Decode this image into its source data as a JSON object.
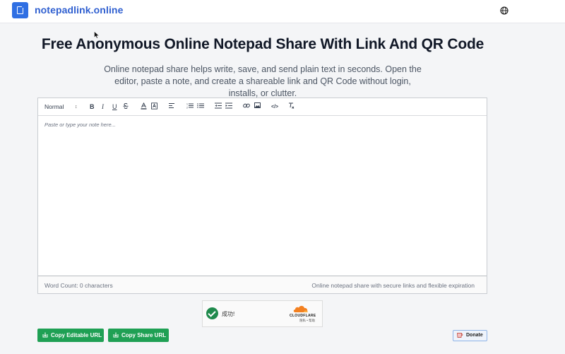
{
  "header": {
    "brand": "notepadlink.online",
    "logo_icon": "document-icon",
    "language_icon": "globe-icon"
  },
  "main": {
    "title": "Free Anonymous Online Notepad Share With Link And QR Code",
    "subtitle": "Online notepad share helps write, save, and send plain text in seconds. Open the editor, paste a note, and create a shareable link and QR Code without login, installs, or clutter."
  },
  "editor": {
    "toolbar": {
      "format_value": "Normal",
      "bold_label": "B",
      "italic_label": "I",
      "underline_label": "U",
      "code_label": "</>",
      "icons": [
        "format-select",
        "bold-icon",
        "italic-icon",
        "underline-icon",
        "strikethrough-icon",
        "text-color-icon",
        "background-color-icon",
        "align-icon",
        "ordered-list-icon",
        "bullet-list-icon",
        "outdent-icon",
        "indent-icon",
        "link-icon",
        "image-icon",
        "code-icon",
        "clear-format-icon"
      ]
    },
    "placeholder": "Paste or type your note here...",
    "word_count": "Word Count: 0 characters",
    "tagline": "Online notepad share with secure links and flexible expiration"
  },
  "captcha": {
    "status": "成功!",
    "brand": "CLOUDFLARE",
    "links": "隐私 • 帮助"
  },
  "actions": {
    "copy_editable": "Copy Editable URL",
    "copy_share": "Copy Share URL",
    "donate": "Donate"
  },
  "colors": {
    "brand_blue": "#2f6fe3",
    "button_green": "#1fa054",
    "captcha_green": "#1f8a4c",
    "cloudflare_orange": "#f38020"
  }
}
